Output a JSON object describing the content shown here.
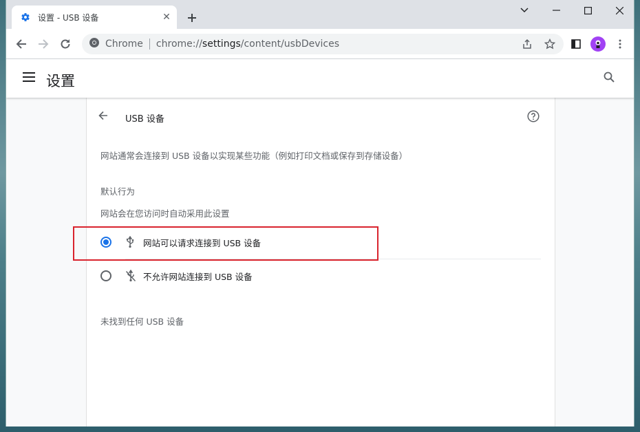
{
  "tab": {
    "title": "设置 - USB 设备",
    "close": "✕"
  },
  "omnibox": {
    "site_label": "Chrome",
    "url_prefix": "chrome://",
    "url_host": "settings",
    "url_path": "/content/usbDevices"
  },
  "header": {
    "title": "设置"
  },
  "page": {
    "heading": "USB 设备",
    "description": "网站通常会连接到 USB 设备以实现某些功能（例如打印文档或保存到存储设备）",
    "default_behavior_title": "默认行为",
    "default_behavior_sub": "网站会在您访问时自动采用此设置",
    "options": [
      {
        "label": "网站可以请求连接到 USB 设备",
        "checked": true,
        "icon": "usb-icon"
      },
      {
        "label": "不允许网站连接到 USB 设备",
        "checked": false,
        "icon": "usb-off-icon"
      }
    ],
    "empty_message": "未找到任何 USB 设备"
  },
  "colors": {
    "accent": "#1a73e8",
    "highlight": "#d9232d"
  }
}
